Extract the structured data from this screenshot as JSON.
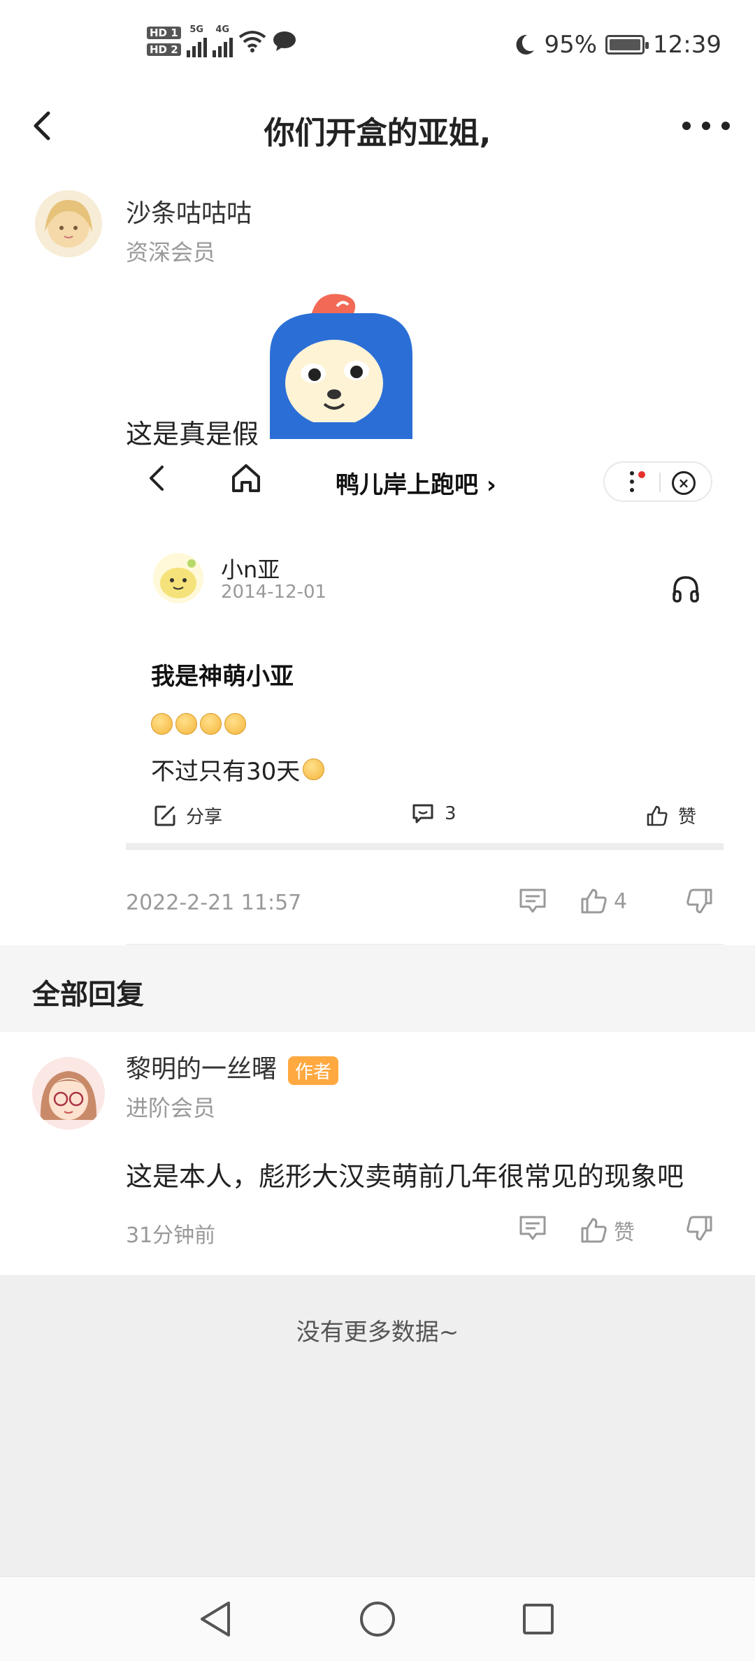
{
  "status_bar": {
    "hd1": "HD 1",
    "hd2": "HD 2",
    "net1": "5G",
    "net2": "4G",
    "battery": "95%",
    "time": "12:39"
  },
  "header": {
    "title": "你们开盒的亚姐,"
  },
  "post": {
    "author_name": "沙条咕咕咕",
    "author_level": "资深会员",
    "text": "这是真是假",
    "date": "2022-2-21 11:57",
    "like_count": "4"
  },
  "embed": {
    "title": "鸭儿岸上跑吧 ›",
    "user": "小n亚",
    "date": "2014-12-01",
    "headline": "我是神萌小亚",
    "line": "不过只有30天",
    "share_label": "分享",
    "comment_count": "3",
    "like_label": "赞"
  },
  "replies_section": {
    "title": "全部回复"
  },
  "reply": {
    "author_name": "黎明的一丝曙",
    "badge": "作者",
    "author_level": "进阶会员",
    "text": "这是本人，彪形大汉卖萌前几年很常见的现象吧",
    "time": "31分钟前",
    "like_label": "赞"
  },
  "footer": {
    "text": "没有更多数据~"
  },
  "colors": {
    "badge": "#ffa940",
    "muted": "#999999",
    "section_bg": "#f5f5f5"
  }
}
